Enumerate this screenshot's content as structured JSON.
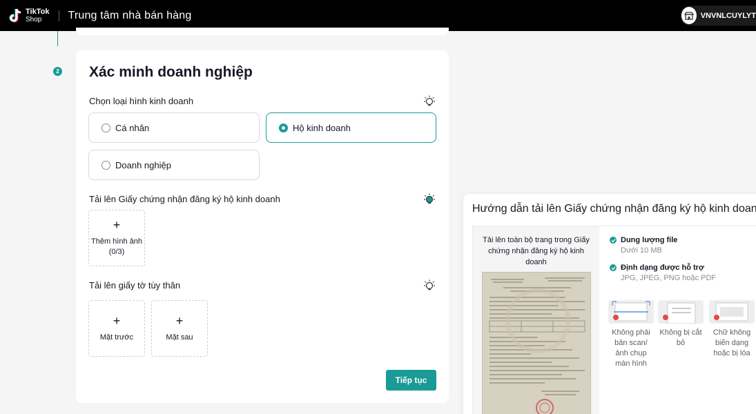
{
  "header": {
    "logo_line1": "TikTok",
    "logo_line2": "Shop",
    "app_title": "Trung tâm nhà bán hàng",
    "user_name": "VNVNLCUYLYT"
  },
  "step": {
    "number": "2"
  },
  "card": {
    "title": "Xác minh doanh nghiệp",
    "business_type": {
      "label": "Chọn loại hình kinh doanh",
      "options": [
        {
          "label": "Cá nhân",
          "selected": false
        },
        {
          "label": "Hộ kinh doanh",
          "selected": true
        },
        {
          "label": "Doanh nghiệp",
          "selected": false
        }
      ]
    },
    "certificate": {
      "label": "Tải lên Giấy chứng nhận đăng ký hộ kinh doanh",
      "upload_label": "Thêm hình ảnh",
      "upload_count": "(0/3)"
    },
    "id_docs": {
      "label": "Tải lên giấy tờ tùy thân",
      "front_label": "Mặt trước",
      "back_label": "Mặt sau"
    },
    "continue_label": "Tiếp tục"
  },
  "guide": {
    "title": "Hướng dẫn tải lên Giấy chứng nhận đăng ký hộ kinh doanh",
    "sample_caption": "Tải lên toàn bộ trang trong Giấy chứng nhận đăng ký hộ kinh doanh",
    "requirements": [
      {
        "title": "Dung lượng file",
        "desc": "Dưới 10 MB"
      },
      {
        "title": "Định dạng được hỗ trợ",
        "desc": "JPG, JPEG, PNG hoặc PDF"
      }
    ],
    "bad_examples": [
      {
        "label": "Không phải bản scan/ ảnh chụp màn hình"
      },
      {
        "label": "Không bị cắt bỏ"
      },
      {
        "label": "Chữ không biến dạng hoặc bị lóa"
      }
    ]
  },
  "colors": {
    "accent": "#1a9b95",
    "error": "#e54848",
    "topbar": "#000000"
  }
}
